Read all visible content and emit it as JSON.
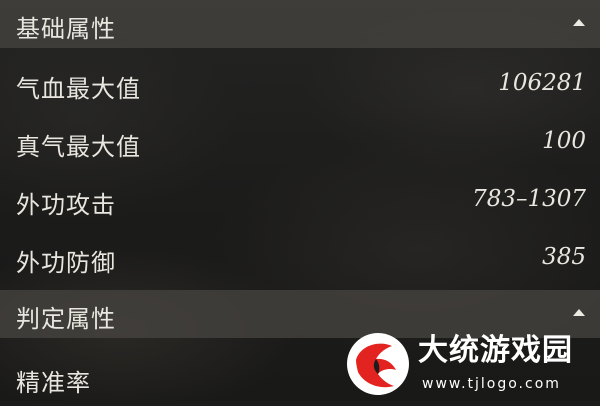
{
  "sections": [
    {
      "title": "基础属性",
      "rows": [
        {
          "label": "气血最大值",
          "value": "106281"
        },
        {
          "label": "真气最大值",
          "value": "100"
        },
        {
          "label": "外功攻击",
          "value": "783–1307"
        },
        {
          "label": "外功防御",
          "value": "385"
        }
      ]
    },
    {
      "title": "判定属性",
      "rows": [
        {
          "label": "精准率",
          "value": ""
        }
      ]
    }
  ],
  "watermark": {
    "name": "大统游戏园",
    "url": "www.tjlogo.com"
  },
  "colors": {
    "header_bg": "#464440",
    "text": "#e9e6df",
    "watermark_red": "#e3231f"
  },
  "icons": {
    "collapse": "caret-up-icon",
    "logo": "watermark-logo-icon"
  }
}
